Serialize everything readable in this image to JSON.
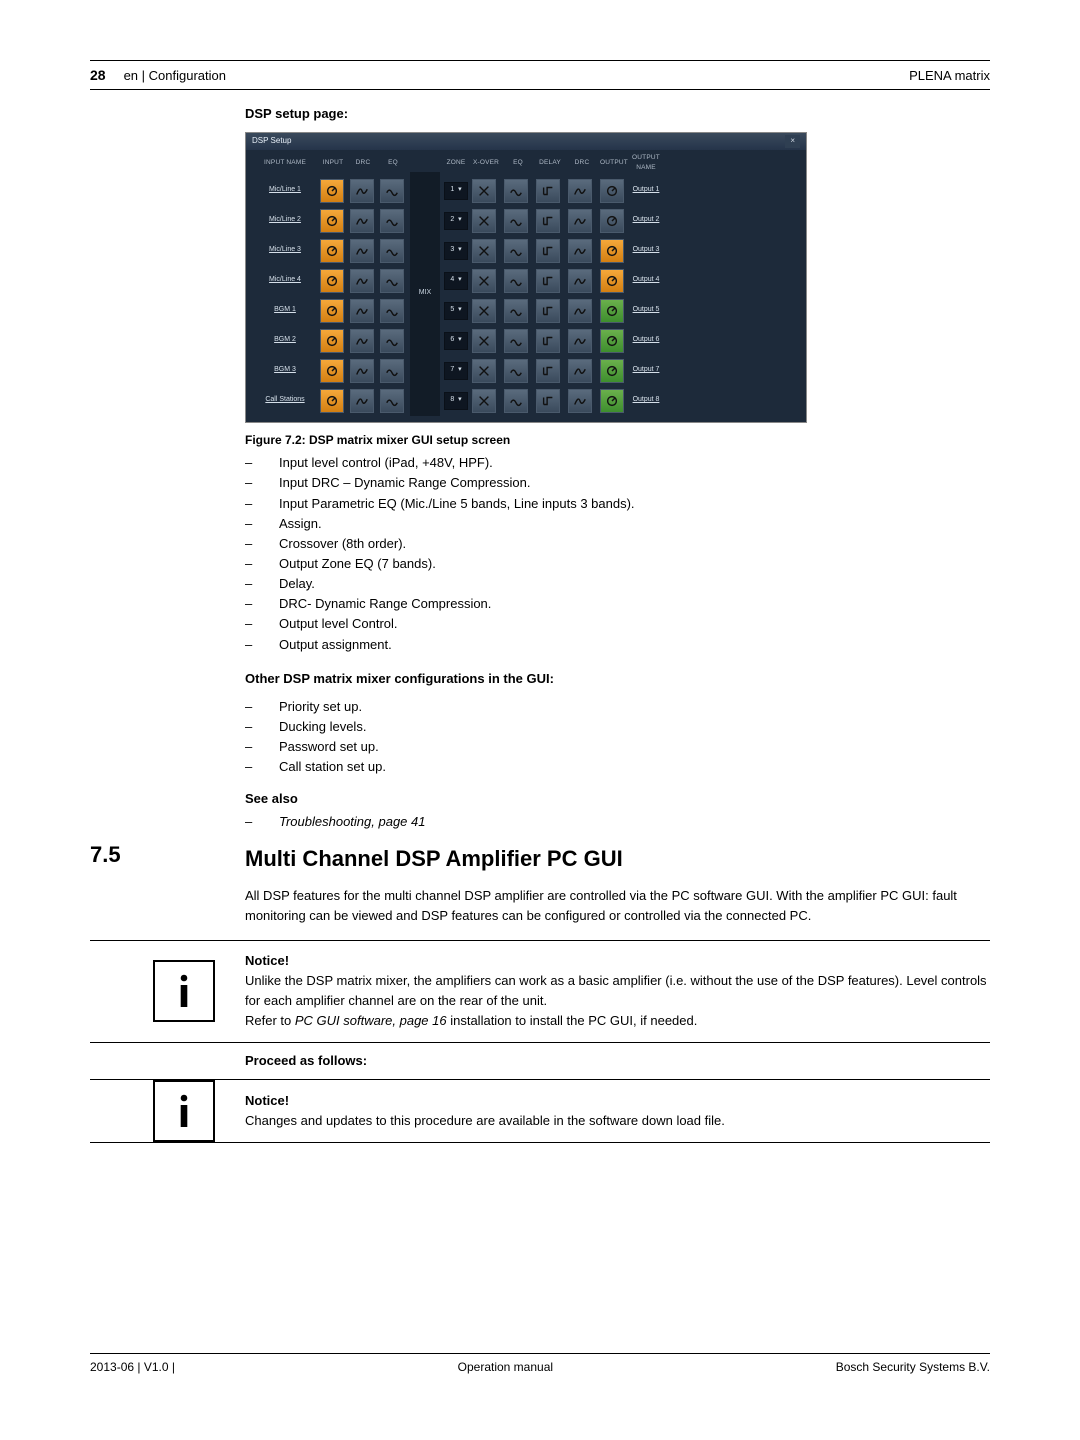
{
  "header": {
    "page_number": "28",
    "breadcrumb": "en | Configuration",
    "product": "PLENA matrix"
  },
  "footer": {
    "left": "2013-06 | V1.0 |",
    "center": "Operation manual",
    "right": "Bosch Security Systems B.V."
  },
  "section_title": "DSP setup page:",
  "figure_caption": "Figure 7.2: DSP matrix mixer GUI setup screen",
  "screenshot": {
    "window_title": "DSP Setup",
    "close": "×",
    "mix": "MIX",
    "columns": [
      "INPUT NAME",
      "INPUT",
      "DRC",
      "EQ",
      "",
      "ZONE",
      "X-OVER",
      "EQ",
      "DELAY",
      "DRC",
      "OUTPUT",
      "OUTPUT NAME"
    ],
    "rows": [
      {
        "input": "Mic/Line 1",
        "zone": "1",
        "output": "Output 1"
      },
      {
        "input": "Mic/Line 2",
        "zone": "2",
        "output": "Output 2"
      },
      {
        "input": "Mic/Line 3",
        "zone": "3",
        "output": "Output 3"
      },
      {
        "input": "Mic/Line 4",
        "zone": "4",
        "output": "Output 4"
      },
      {
        "input": "BGM 1",
        "zone": "5",
        "output": "Output 5"
      },
      {
        "input": "BGM 2",
        "zone": "6",
        "output": "Output 6"
      },
      {
        "input": "BGM 3",
        "zone": "7",
        "output": "Output 7"
      },
      {
        "input": "Call Stations",
        "zone": "8",
        "output": "Output 8"
      }
    ]
  },
  "feature_bullets": [
    "Input level control (iPad, +48V, HPF).",
    "Input DRC – Dynamic Range Compression.",
    "Input Parametric EQ (Mic./Line 5 bands, Line inputs 3 bands).",
    "Assign.",
    "Crossover (8th order).",
    "Output Zone EQ (7 bands).",
    "Delay.",
    "DRC- Dynamic Range Compression.",
    "Output level Control.",
    "Output assignment."
  ],
  "other_heading": "Other DSP matrix mixer configurations in the GUI:",
  "other_bullets": [
    "Priority set up.",
    "Ducking levels.",
    "Password set up.",
    "Call station set up."
  ],
  "see_also": {
    "label": "See also",
    "link": "Troubleshooting, page 41"
  },
  "section75": {
    "number": "7.5",
    "title": "Multi Channel DSP Amplifier PC GUI",
    "para": "All DSP features for the multi channel DSP amplifier are controlled via the PC software GUI. With the amplifier PC GUI: fault monitoring can be viewed and DSP features can be configured or controlled via the connected PC."
  },
  "notice1": {
    "title": "Notice!",
    "line1": "Unlike the DSP matrix mixer, the amplifiers can work as a basic amplifier (i.e. without the use of the DSP features). Level controls for each amplifier channel are on the rear of the unit.",
    "line2_prefix": "Refer to ",
    "line2_italic": "PC GUI software, page 16",
    "line2_suffix": " installation to install the PC GUI, if needed."
  },
  "proceed": "Proceed as follows:",
  "notice2": {
    "title": "Notice!",
    "body": "Changes and updates to this procedure are available in the software down load file."
  }
}
